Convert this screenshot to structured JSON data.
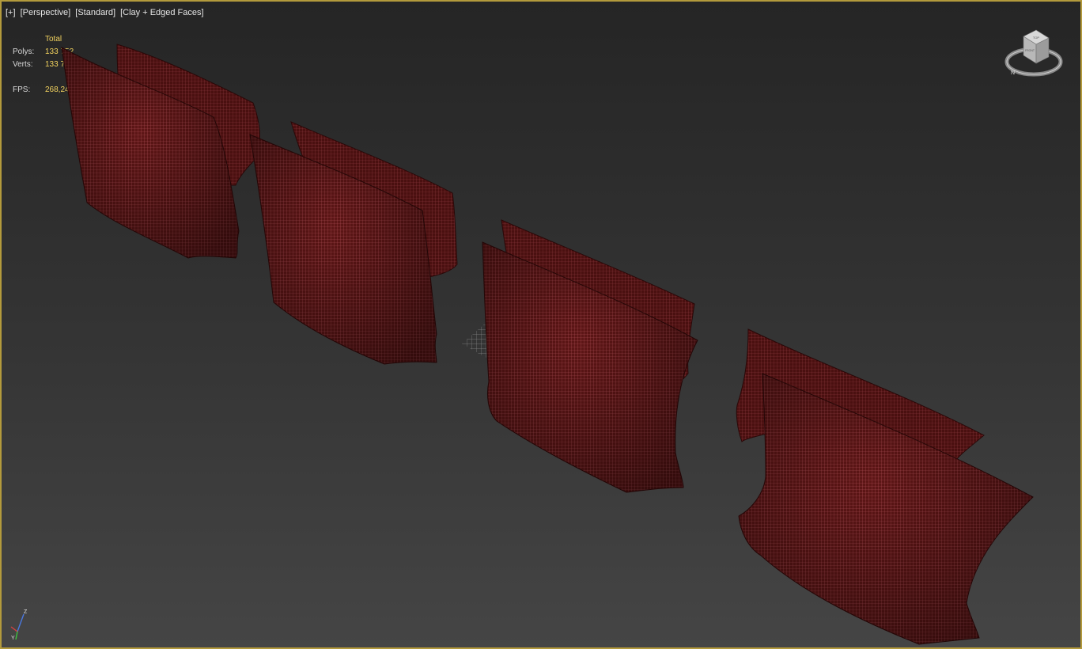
{
  "viewport": {
    "labels": [
      "[+]",
      "[Perspective]",
      "[Standard]",
      "[Clay + Edged Faces]"
    ],
    "stats": {
      "header": "Total",
      "polys_label": "Polys:",
      "polys_value": "133 752",
      "verts_label": "Verts:",
      "verts_value": "133 764",
      "fps_label": "FPS:",
      "fps_value": "268,243"
    },
    "viewcube": {
      "top_face_text": "TOP",
      "front_face_text": "FRONT",
      "compass_north": "N"
    },
    "axis_labels": {
      "z": "Z",
      "y": "Y",
      "x": "X"
    }
  },
  "colors": {
    "viewport_border": "#b39a3c",
    "pillow_mesh": "#7a1e1e",
    "stats_value": "#f2d25e",
    "label_text": "#e6e6e6"
  },
  "scene": {
    "objects": [
      "pillow-pair-1",
      "pillow-pair-2",
      "pillow-pair-3",
      "pillow-pair-4",
      "grid-helper"
    ]
  }
}
